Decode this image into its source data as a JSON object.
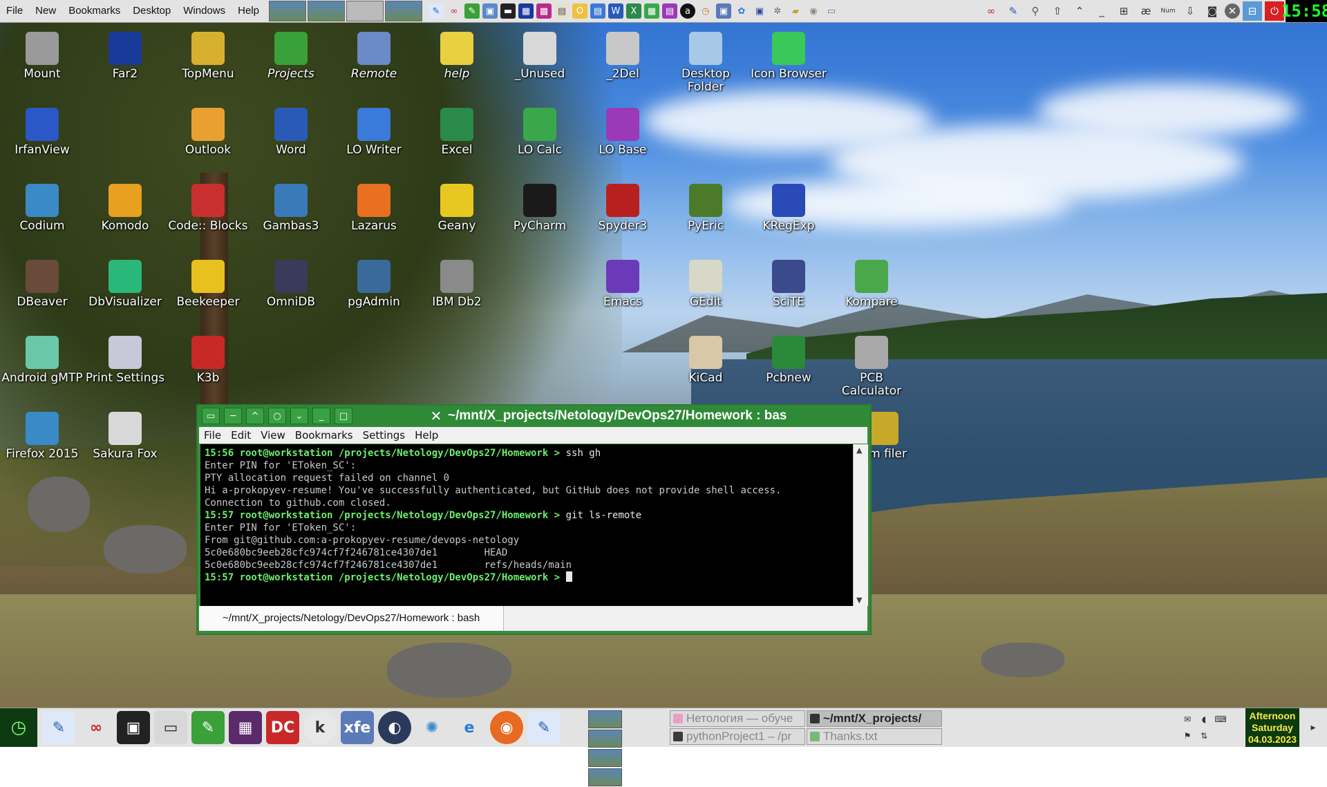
{
  "top_panel": {
    "menu": [
      "File",
      "New",
      "Bookmarks",
      "Desktop",
      "Windows",
      "Help"
    ],
    "clock": "15:58"
  },
  "desktop_icons": [
    {
      "label": "Mount",
      "icon": "drive-icon",
      "color": "#9a9a9a"
    },
    {
      "label": "Far2",
      "icon": "far-manager-icon",
      "color": "#1a3a9a"
    },
    {
      "label": "TopMenu",
      "icon": "warning-folder-icon",
      "color": "#d8b030"
    },
    {
      "label": "Projects",
      "icon": "folder-green-icon",
      "color": "#3aa03a",
      "italic": true
    },
    {
      "label": "Remote",
      "icon": "computer-icon",
      "color": "#6a8ac8",
      "italic": true
    },
    {
      "label": "help",
      "icon": "folder-yellow-icon",
      "color": "#e8d040",
      "italic": true
    },
    {
      "label": "_Unused",
      "icon": "folder-white-icon",
      "color": "#d8d8d8"
    },
    {
      "label": "_2Del",
      "icon": "folder-white-icon",
      "color": "#c8c8c8"
    },
    {
      "label": "Desktop Folder",
      "icon": "igloo-icon",
      "color": "#a8c8e8"
    },
    {
      "label": "Icon Browser",
      "icon": "flask-icon",
      "color": "#3ac85a"
    },
    {
      "label": "IrfanView",
      "icon": "irfanview-icon",
      "color": "#2a58c8"
    },
    {
      "label": "Outlook",
      "icon": "outlook-icon",
      "color": "#e8a030"
    },
    {
      "label": "Word",
      "icon": "word-icon",
      "color": "#2a5ab8"
    },
    {
      "label": "LO Writer",
      "icon": "lo-writer-icon",
      "color": "#3a7ad8"
    },
    {
      "label": "Excel",
      "icon": "excel-icon",
      "color": "#2a8a4a"
    },
    {
      "label": "LO Calc",
      "icon": "lo-calc-icon",
      "color": "#3aa84a"
    },
    {
      "label": "LO Base",
      "icon": "lo-base-icon",
      "color": "#9a3ab8"
    },
    {
      "label": "Codium",
      "icon": "codium-icon",
      "color": "#3a8ac8"
    },
    {
      "label": "Komodo",
      "icon": "komodo-icon",
      "color": "#e8a020"
    },
    {
      "label": "Code:: Blocks",
      "icon": "codeblocks-icon",
      "color": "#c83030"
    },
    {
      "label": "Gambas3",
      "icon": "gambas-icon",
      "color": "#3a7ab8"
    },
    {
      "label": "Lazarus",
      "icon": "lazarus-icon",
      "color": "#e87020"
    },
    {
      "label": "Geany",
      "icon": "geany-icon",
      "color": "#e8c820"
    },
    {
      "label": "PyCharm",
      "icon": "pycharm-icon",
      "color": "#1a1a1a"
    },
    {
      "label": "Spyder3",
      "icon": "spyder-icon",
      "color": "#b82020"
    },
    {
      "label": "PyEric",
      "icon": "eric-icon",
      "color": "#4a7a2a"
    },
    {
      "label": "KRegExp",
      "icon": "kregexp-icon",
      "color": "#2a4ab8"
    },
    {
      "label": "DBeaver",
      "icon": "dbeaver-icon",
      "color": "#6a4a3a"
    },
    {
      "label": "DbVisualizer",
      "icon": "dbvisualizer-icon",
      "color": "#2ab87a"
    },
    {
      "label": "Beekeeper",
      "icon": "beekeeper-icon",
      "color": "#e8c020"
    },
    {
      "label": "OmniDB",
      "icon": "omnidb-icon",
      "color": "#3a3a5a"
    },
    {
      "label": "pgAdmin",
      "icon": "elephant-icon",
      "color": "#3a6a9a"
    },
    {
      "label": "IBM Db2",
      "icon": "database-icon",
      "color": "#8a8a8a"
    },
    {
      "label": "Emacs",
      "icon": "emacs-icon",
      "color": "#6a3ab8"
    },
    {
      "label": "GEdit",
      "icon": "gedit-icon",
      "color": "#d8d8c8"
    },
    {
      "label": "SciTE",
      "icon": "scite-icon",
      "color": "#3a4a8a"
    },
    {
      "label": "Kompare",
      "icon": "kompare-icon",
      "color": "#4aa84a"
    },
    {
      "label": "Android gMTP",
      "icon": "android-phone-icon",
      "color": "#6ac8a8"
    },
    {
      "label": "Print Settings",
      "icon": "printer-icon",
      "color": "#c8c8d8"
    },
    {
      "label": "K3b",
      "icon": "k3b-icon",
      "color": "#c82828"
    },
    {
      "label": "KiCad",
      "icon": "kicad-icon",
      "color": "#d8c8a8"
    },
    {
      "label": "Pcbnew",
      "icon": "pcbnew-icon",
      "color": "#2a8a3a"
    },
    {
      "label": "PCB Calculator",
      "icon": "calculator-icon",
      "color": "#a8a8a8"
    },
    {
      "label": "Firefox 2015",
      "icon": "globe-icon",
      "color": "#3a8ac8"
    },
    {
      "label": "Sakura Fox",
      "icon": "smiley-icon",
      "color": "#d8d8d8"
    },
    {
      "label": "tem filer",
      "icon": "filer-icon",
      "color": "#c8a828"
    }
  ],
  "terminal": {
    "title": "~/mnt/X_projects/Netology/DevOps27/Homework : bas",
    "menu": [
      "File",
      "Edit",
      "View",
      "Bookmarks",
      "Settings",
      "Help"
    ],
    "lines": [
      {
        "type": "prompt",
        "prompt": "15:56 root@workstation /projects/Netology/DevOps27/Homework > ",
        "cmd": "ssh gh"
      },
      {
        "type": "out",
        "text": "Enter PIN for 'EToken_SC':"
      },
      {
        "type": "out",
        "text": "PTY allocation request failed on channel 0"
      },
      {
        "type": "out",
        "text": "Hi a-prokopyev-resume! You've successfully authenticated, but GitHub does not provide shell access."
      },
      {
        "type": "out",
        "text": "Connection to github.com closed."
      },
      {
        "type": "prompt",
        "prompt": "15:57 root@workstation /projects/Netology/DevOps27/Homework > ",
        "cmd": "git ls-remote"
      },
      {
        "type": "out",
        "text": "Enter PIN for 'EToken_SC':"
      },
      {
        "type": "out",
        "text": "From git@github.com:a-prokopyev-resume/devops-netology"
      },
      {
        "type": "out",
        "text": "5c0e680bc9eeb28cfc974cf7f246781ce4307de1        HEAD"
      },
      {
        "type": "out",
        "text": "5c0e680bc9eeb28cfc974cf7f246781ce4307de1        refs/heads/main"
      },
      {
        "type": "prompt",
        "prompt": "15:57 root@workstation /projects/Netology/DevOps27/Homework > ",
        "cmd": "",
        "cursor": true
      }
    ],
    "tab_label": "~/mnt/X_projects/Netology/DevOps27/Homework : bash"
  },
  "bottom_panel": {
    "tasks": [
      {
        "label": "Нетология — обуче",
        "active": false
      },
      {
        "label": "~/mnt/X_projects/",
        "active": true
      },
      {
        "label": "pythonProject1 – /pr",
        "active": false
      },
      {
        "label": "Thanks.txt",
        "active": false
      }
    ],
    "date": {
      "line1": "Afternoon",
      "line2": "Saturday",
      "line3": "04.03.2023"
    }
  }
}
